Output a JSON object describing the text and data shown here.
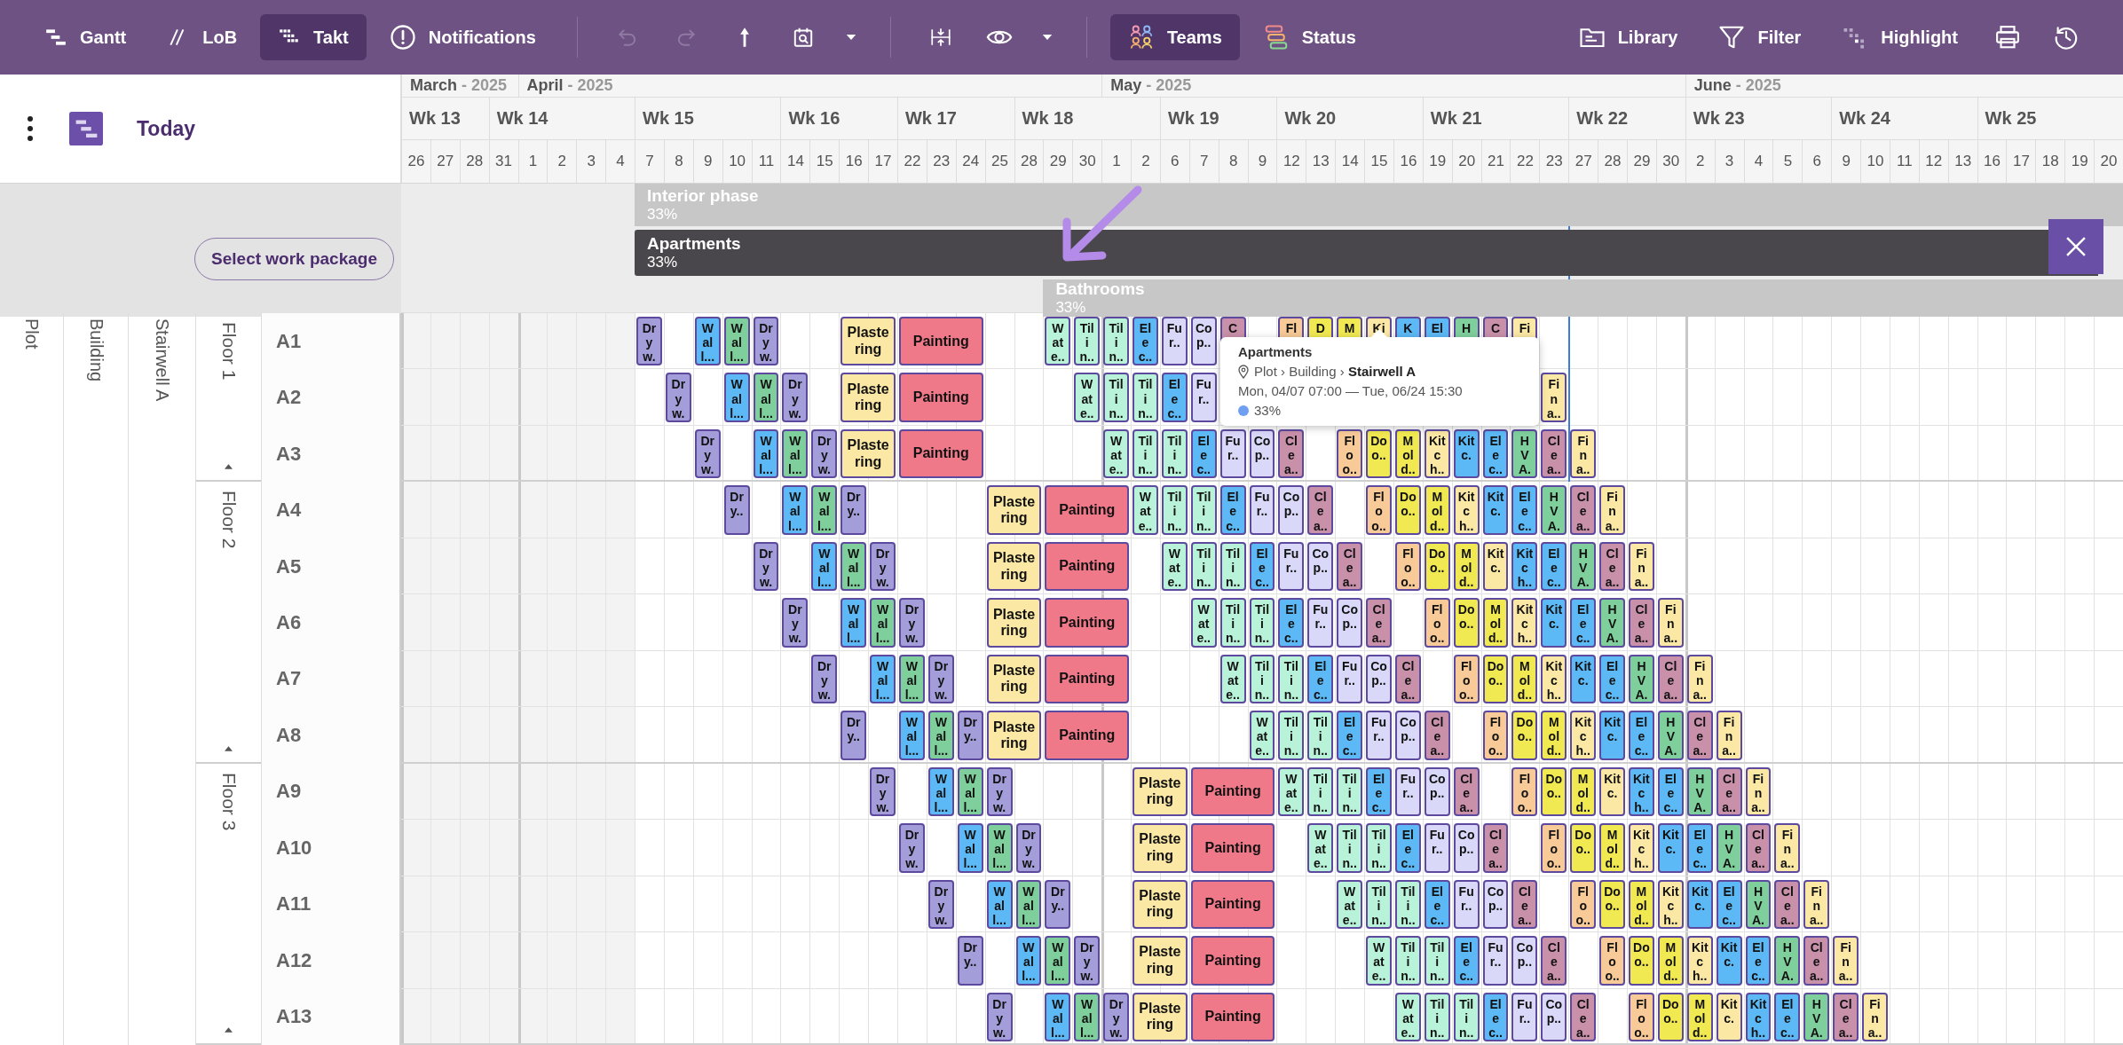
{
  "toolbar": {
    "views": [
      {
        "kind": "gantt",
        "label": "Gantt",
        "selected": false
      },
      {
        "kind": "lob",
        "label": "LoB",
        "selected": false
      },
      {
        "kind": "takt",
        "label": "Takt",
        "selected": true
      }
    ],
    "notifications": {
      "label": "Notifications"
    },
    "actions": [
      {
        "kind": "undo",
        "disabled": true
      },
      {
        "kind": "redo",
        "disabled": true
      },
      {
        "kind": "pin",
        "disabled": false
      },
      {
        "kind": "calendar",
        "disabled": false
      },
      {
        "kind": "caret",
        "disabled": false
      }
    ],
    "view_actions": [
      {
        "kind": "compress"
      },
      {
        "kind": "eye"
      },
      {
        "kind": "caret"
      }
    ],
    "modes": [
      {
        "kind": "teams",
        "label": "Teams",
        "selected": true
      },
      {
        "kind": "status",
        "label": "Status",
        "selected": false
      }
    ],
    "tools": [
      {
        "kind": "library",
        "label": "Library"
      },
      {
        "kind": "filter",
        "label": "Filter"
      },
      {
        "kind": "highlight",
        "label": "Highlight"
      }
    ],
    "utilities": [
      {
        "kind": "print"
      },
      {
        "kind": "history"
      }
    ]
  },
  "sidebar_header": {
    "today": "Today"
  },
  "timeline": {
    "weeks": [
      {
        "label": "Wk 13",
        "shaded": true,
        "days": [
          {
            "label": "26",
            "month": {
              "name": "March",
              "year": "- 2025"
            }
          },
          {
            "label": "27"
          },
          {
            "label": "28"
          }
        ]
      },
      {
        "label": "Wk 14",
        "shaded": true,
        "days": [
          {
            "label": "31"
          },
          {
            "label": "1",
            "month": {
              "name": "April",
              "year": "- 2025"
            }
          },
          {
            "label": "2"
          },
          {
            "label": "3"
          },
          {
            "label": "4"
          }
        ]
      },
      {
        "label": "Wk 15",
        "shaded": false,
        "days": [
          {
            "label": "7"
          },
          {
            "label": "8"
          },
          {
            "label": "9"
          },
          {
            "label": "10"
          },
          {
            "label": "11"
          }
        ]
      },
      {
        "label": "Wk 16",
        "shaded": false,
        "days": [
          {
            "label": "14"
          },
          {
            "label": "15"
          },
          {
            "label": "16"
          },
          {
            "label": "17"
          }
        ]
      },
      {
        "label": "Wk 17",
        "shaded": false,
        "days": [
          {
            "label": "22"
          },
          {
            "label": "23"
          },
          {
            "label": "24"
          },
          {
            "label": "25"
          }
        ]
      },
      {
        "label": "Wk 18",
        "shaded": false,
        "days": [
          {
            "label": "28"
          },
          {
            "label": "29"
          },
          {
            "label": "30"
          },
          {
            "label": "1",
            "month": {
              "name": "May",
              "year": "- 2025"
            }
          },
          {
            "label": "2"
          }
        ]
      },
      {
        "label": "Wk 19",
        "shaded": false,
        "days": [
          {
            "label": "6"
          },
          {
            "label": "7"
          },
          {
            "label": "8"
          },
          {
            "label": "9"
          }
        ]
      },
      {
        "label": "Wk 20",
        "shaded": false,
        "days": [
          {
            "label": "12"
          },
          {
            "label": "13"
          },
          {
            "label": "14"
          },
          {
            "label": "15"
          },
          {
            "label": "16"
          }
        ]
      },
      {
        "label": "Wk 21",
        "shaded": false,
        "days": [
          {
            "label": "19"
          },
          {
            "label": "20"
          },
          {
            "label": "21"
          },
          {
            "label": "22"
          },
          {
            "label": "23"
          }
        ]
      },
      {
        "label": "Wk 22",
        "shaded": false,
        "days": [
          {
            "label": "27"
          },
          {
            "label": "28"
          },
          {
            "label": "29"
          },
          {
            "label": "30"
          }
        ]
      },
      {
        "label": "Wk 23",
        "shaded": false,
        "days": [
          {
            "label": "2",
            "month": {
              "name": "June",
              "year": "- 2025"
            }
          },
          {
            "label": "3"
          },
          {
            "label": "4"
          },
          {
            "label": "5"
          },
          {
            "label": "6"
          }
        ]
      },
      {
        "label": "Wk 24",
        "shaded": false,
        "days": [
          {
            "label": "9"
          },
          {
            "label": "10"
          },
          {
            "label": "11"
          },
          {
            "label": "12"
          },
          {
            "label": "13"
          }
        ]
      },
      {
        "label": "Wk 25",
        "shaded": false,
        "days": [
          {
            "label": "16"
          },
          {
            "label": "17"
          },
          {
            "label": "18"
          },
          {
            "label": "19"
          },
          {
            "label": "20"
          }
        ]
      }
    ]
  },
  "work_packages": {
    "button": "Select work package",
    "phases": [
      {
        "name": "Interior phase",
        "progress": "33%",
        "selected": false
      },
      {
        "name": "Apartments",
        "progress": "33%",
        "selected": true
      },
      {
        "name": "Bathrooms",
        "progress": "33%",
        "selected": false
      }
    ]
  },
  "location": {
    "plot": "Plot",
    "building": "Building",
    "stairwell": "Stairwell A",
    "floors": [
      {
        "label": "Floor 1",
        "rows": [
          {
            "label": "A1",
            "tasks": [
              {
                "name": "Dryw.",
                "color": "#a39dd9"
              },
              {
                "name": "Wall...",
                "color": "#5cb9f6"
              },
              {
                "name": "Wall...",
                "color": "#7fcf9c"
              },
              {
                "name": "Dryw.",
                "color": "#a39dd9"
              },
              {
                "name": "Plastering",
                "color": "#fbe8a4"
              },
              {
                "name": "Painting",
                "color": "#ef7889"
              },
              {
                "name": "Wate..",
                "color": "#b8f2d8"
              },
              {
                "name": "Tilin..",
                "color": "#b8f2d8"
              },
              {
                "name": "Tilin..",
                "color": "#b8f2d8"
              },
              {
                "name": "Elec..",
                "color": "#5cb9f6"
              },
              {
                "name": "Fur..",
                "color": "#d9d8f8"
              },
              {
                "name": "Cop..",
                "color": "#d9d8f8"
              },
              {
                "name": "C",
                "color": "#c990aa"
              },
              {
                "name": "Fl",
                "color": "#f7ca97"
              },
              {
                "name": "D",
                "color": "#f1e951"
              },
              {
                "name": "M",
                "color": "#f1e951"
              },
              {
                "name": "Ki",
                "color": "#fbe8a4"
              },
              {
                "name": "K",
                "color": "#5cb9f6"
              },
              {
                "name": "El",
                "color": "#5cb9f6"
              },
              {
                "name": "H",
                "color": "#7fcf9c"
              },
              {
                "name": "C",
                "color": "#c990aa"
              },
              {
                "name": "Fi",
                "color": "#fbe8a4"
              }
            ]
          },
          {
            "label": "A2",
            "tasks": [
              {
                "name": "Dryw.",
                "color": "#a39dd9"
              },
              {
                "name": "Wall...",
                "color": "#5cb9f6"
              },
              {
                "name": "Wall...",
                "color": "#7fcf9c"
              },
              {
                "name": "Dryw.",
                "color": "#a39dd9"
              },
              {
                "name": "Plastering",
                "color": "#fbe8a4"
              },
              {
                "name": "Painting",
                "color": "#ef7889"
              },
              {
                "name": "Wate..",
                "color": "#b8f2d8"
              },
              {
                "name": "Tilin..",
                "color": "#b8f2d8"
              },
              {
                "name": "Tilin..",
                "color": "#b8f2d8"
              },
              {
                "name": "Elec..",
                "color": "#5cb9f6"
              },
              {
                "name": "Fur..",
                "color": "#d9d8f8"
              },
              {
                "name": "Fina..",
                "color": "#fbe8a4"
              }
            ]
          },
          {
            "label": "A3",
            "tasks": [
              {
                "name": "Dryw.",
                "color": "#a39dd9"
              },
              {
                "name": "Wall...",
                "color": "#5cb9f6"
              },
              {
                "name": "Wall...",
                "color": "#7fcf9c"
              },
              {
                "name": "Dryw.",
                "color": "#a39dd9"
              },
              {
                "name": "Plastering",
                "color": "#fbe8a4"
              },
              {
                "name": "Painting",
                "color": "#ef7889"
              },
              {
                "name": "Wate..",
                "color": "#b8f2d8"
              },
              {
                "name": "Tilin..",
                "color": "#b8f2d8"
              },
              {
                "name": "Tilin..",
                "color": "#b8f2d8"
              },
              {
                "name": "Elec..",
                "color": "#5cb9f6"
              },
              {
                "name": "Fur..",
                "color": "#d9d8f8"
              },
              {
                "name": "Cop..",
                "color": "#d9d8f8"
              },
              {
                "name": "Clea..",
                "color": "#c990aa"
              },
              {
                "name": "Floo..",
                "color": "#f7ca97"
              },
              {
                "name": "Doo..",
                "color": "#f1e951"
              },
              {
                "name": "Mold..",
                "color": "#f1e951"
              },
              {
                "name": "Kitch..",
                "color": "#fbe8a4"
              },
              {
                "name": "Kitc.",
                "color": "#5cb9f6"
              },
              {
                "name": "Elec..",
                "color": "#5cb9f6"
              },
              {
                "name": "HVA.",
                "color": "#7fcf9c"
              },
              {
                "name": "Clea..",
                "color": "#c990aa"
              },
              {
                "name": "Fina..",
                "color": "#fbe8a4"
              }
            ]
          }
        ]
      },
      {
        "label": "Floor 2",
        "rows": [
          {
            "label": "A4",
            "tasks": [
              {
                "name": "Dry..",
                "color": "#a39dd9"
              },
              {
                "name": "Wall...",
                "color": "#5cb9f6"
              },
              {
                "name": "Wall...",
                "color": "#7fcf9c"
              },
              {
                "name": "Dry..",
                "color": "#a39dd9"
              },
              {
                "name": "Plastering",
                "color": "#fbe8a4"
              },
              {
                "name": "Painting",
                "color": "#ef7889"
              },
              {
                "name": "Wate..",
                "color": "#b8f2d8"
              },
              {
                "name": "Tilin..",
                "color": "#b8f2d8"
              },
              {
                "name": "Tilin..",
                "color": "#b8f2d8"
              },
              {
                "name": "Elec..",
                "color": "#5cb9f6"
              },
              {
                "name": "Fur..",
                "color": "#d9d8f8"
              },
              {
                "name": "Cop..",
                "color": "#d9d8f8"
              },
              {
                "name": "Clea..",
                "color": "#c990aa"
              },
              {
                "name": "Floo..",
                "color": "#f7ca97"
              },
              {
                "name": "Doo..",
                "color": "#f1e951"
              },
              {
                "name": "Mold..",
                "color": "#f1e951"
              },
              {
                "name": "Kitch..",
                "color": "#fbe8a4"
              },
              {
                "name": "Kitc.",
                "color": "#5cb9f6"
              },
              {
                "name": "Elec..",
                "color": "#5cb9f6"
              },
              {
                "name": "HVA.",
                "color": "#7fcf9c"
              },
              {
                "name": "Clea..",
                "color": "#c990aa"
              },
              {
                "name": "Fina..",
                "color": "#fbe8a4"
              }
            ]
          },
          {
            "label": "A5",
            "tasks": [
              {
                "name": "Dryw.",
                "color": "#a39dd9"
              },
              {
                "name": "Wall...",
                "color": "#5cb9f6"
              },
              {
                "name": "Wall...",
                "color": "#7fcf9c"
              },
              {
                "name": "Dryw.",
                "color": "#a39dd9"
              },
              {
                "name": "Plastering",
                "color": "#fbe8a4"
              },
              {
                "name": "Painting",
                "color": "#ef7889"
              },
              {
                "name": "Wate..",
                "color": "#b8f2d8"
              },
              {
                "name": "Tilin..",
                "color": "#b8f2d8"
              },
              {
                "name": "Tilin..",
                "color": "#b8f2d8"
              },
              {
                "name": "Elec..",
                "color": "#5cb9f6"
              },
              {
                "name": "Fur..",
                "color": "#d9d8f8"
              },
              {
                "name": "Cop..",
                "color": "#d9d8f8"
              },
              {
                "name": "Clea..",
                "color": "#c990aa"
              },
              {
                "name": "Floo..",
                "color": "#f7ca97"
              },
              {
                "name": "Doo..",
                "color": "#f1e951"
              },
              {
                "name": "Mold..",
                "color": "#f1e951"
              },
              {
                "name": "Kitc.",
                "color": "#fbe8a4"
              },
              {
                "name": "Kitch..",
                "color": "#5cb9f6"
              },
              {
                "name": "Elec..",
                "color": "#5cb9f6"
              },
              {
                "name": "HVA.",
                "color": "#7fcf9c"
              },
              {
                "name": "Clea..",
                "color": "#c990aa"
              },
              {
                "name": "Fina..",
                "color": "#fbe8a4"
              }
            ]
          },
          {
            "label": "A6",
            "tasks": [
              {
                "name": "Dryw.",
                "color": "#a39dd9"
              },
              {
                "name": "Wall...",
                "color": "#5cb9f6"
              },
              {
                "name": "Wall...",
                "color": "#7fcf9c"
              },
              {
                "name": "Dryw.",
                "color": "#a39dd9"
              },
              {
                "name": "Plastering",
                "color": "#fbe8a4"
              },
              {
                "name": "Painting",
                "color": "#ef7889"
              },
              {
                "name": "Wate..",
                "color": "#b8f2d8"
              },
              {
                "name": "Tilin..",
                "color": "#b8f2d8"
              },
              {
                "name": "Tilin..",
                "color": "#b8f2d8"
              },
              {
                "name": "Elec..",
                "color": "#5cb9f6"
              },
              {
                "name": "Fur..",
                "color": "#d9d8f8"
              },
              {
                "name": "Cop..",
                "color": "#d9d8f8"
              },
              {
                "name": "Clea..",
                "color": "#c990aa"
              },
              {
                "name": "Floo..",
                "color": "#f7ca97"
              },
              {
                "name": "Doo..",
                "color": "#f1e951"
              },
              {
                "name": "Mold..",
                "color": "#f1e951"
              },
              {
                "name": "Kitch..",
                "color": "#fbe8a4"
              },
              {
                "name": "Kitc.",
                "color": "#5cb9f6"
              },
              {
                "name": "Elec..",
                "color": "#5cb9f6"
              },
              {
                "name": "HVA.",
                "color": "#7fcf9c"
              },
              {
                "name": "Clea..",
                "color": "#c990aa"
              },
              {
                "name": "Fina..",
                "color": "#fbe8a4"
              }
            ]
          },
          {
            "label": "A7",
            "tasks": [
              {
                "name": "Dryw.",
                "color": "#a39dd9"
              },
              {
                "name": "Wall...",
                "color": "#5cb9f6"
              },
              {
                "name": "Wall...",
                "color": "#7fcf9c"
              },
              {
                "name": "Dryw.",
                "color": "#a39dd9"
              },
              {
                "name": "Plastering",
                "color": "#fbe8a4"
              },
              {
                "name": "Painting",
                "color": "#ef7889"
              },
              {
                "name": "Wate..",
                "color": "#b8f2d8"
              },
              {
                "name": "Tilin..",
                "color": "#b8f2d8"
              },
              {
                "name": "Tilin..",
                "color": "#b8f2d8"
              },
              {
                "name": "Elec..",
                "color": "#5cb9f6"
              },
              {
                "name": "Fur..",
                "color": "#d9d8f8"
              },
              {
                "name": "Cop..",
                "color": "#d9d8f8"
              },
              {
                "name": "Clea..",
                "color": "#c990aa"
              },
              {
                "name": "Floo..",
                "color": "#f7ca97"
              },
              {
                "name": "Doo..",
                "color": "#f1e951"
              },
              {
                "name": "Mold..",
                "color": "#f1e951"
              },
              {
                "name": "Kitch..",
                "color": "#fbe8a4"
              },
              {
                "name": "Kitc.",
                "color": "#5cb9f6"
              },
              {
                "name": "Elec..",
                "color": "#5cb9f6"
              },
              {
                "name": "HVA.",
                "color": "#7fcf9c"
              },
              {
                "name": "Clea..",
                "color": "#c990aa"
              },
              {
                "name": "Fina..",
                "color": "#fbe8a4"
              }
            ]
          },
          {
            "label": "A8",
            "tasks": [
              {
                "name": "Dry..",
                "color": "#a39dd9"
              },
              {
                "name": "Wall...",
                "color": "#5cb9f6"
              },
              {
                "name": "Wall...",
                "color": "#7fcf9c"
              },
              {
                "name": "Dry..",
                "color": "#a39dd9"
              },
              {
                "name": "Plastering",
                "color": "#fbe8a4"
              },
              {
                "name": "Painting",
                "color": "#ef7889"
              },
              {
                "name": "Wate..",
                "color": "#b8f2d8"
              },
              {
                "name": "Tilin..",
                "color": "#b8f2d8"
              },
              {
                "name": "Tilin..",
                "color": "#b8f2d8"
              },
              {
                "name": "Elec..",
                "color": "#5cb9f6"
              },
              {
                "name": "Fur..",
                "color": "#d9d8f8"
              },
              {
                "name": "Cop..",
                "color": "#d9d8f8"
              },
              {
                "name": "Clea..",
                "color": "#c990aa"
              },
              {
                "name": "Floo..",
                "color": "#f7ca97"
              },
              {
                "name": "Doo..",
                "color": "#f1e951"
              },
              {
                "name": "Mold..",
                "color": "#f1e951"
              },
              {
                "name": "Kitch..",
                "color": "#fbe8a4"
              },
              {
                "name": "Kitc.",
                "color": "#5cb9f6"
              },
              {
                "name": "Elec..",
                "color": "#5cb9f6"
              },
              {
                "name": "HVA.",
                "color": "#7fcf9c"
              },
              {
                "name": "Clea..",
                "color": "#c990aa"
              },
              {
                "name": "Fina..",
                "color": "#fbe8a4"
              }
            ]
          }
        ]
      },
      {
        "label": "Floor 3",
        "rows": [
          {
            "label": "A9",
            "tasks": [
              {
                "name": "Dryw.",
                "color": "#a39dd9"
              },
              {
                "name": "Wall...",
                "color": "#5cb9f6"
              },
              {
                "name": "Wall...",
                "color": "#7fcf9c"
              },
              {
                "name": "Dryw.",
                "color": "#a39dd9"
              },
              {
                "name": "Plastering",
                "color": "#fbe8a4"
              },
              {
                "name": "Painting",
                "color": "#ef7889"
              },
              {
                "name": "Wate..",
                "color": "#b8f2d8"
              },
              {
                "name": "Tilin..",
                "color": "#b8f2d8"
              },
              {
                "name": "Tilin..",
                "color": "#b8f2d8"
              },
              {
                "name": "Elec..",
                "color": "#5cb9f6"
              },
              {
                "name": "Fur..",
                "color": "#d9d8f8"
              },
              {
                "name": "Cop..",
                "color": "#d9d8f8"
              },
              {
                "name": "Clea..",
                "color": "#c990aa"
              },
              {
                "name": "Floo..",
                "color": "#f7ca97"
              },
              {
                "name": "Doo..",
                "color": "#f1e951"
              },
              {
                "name": "Mold..",
                "color": "#f1e951"
              },
              {
                "name": "Kitc.",
                "color": "#fbe8a4"
              },
              {
                "name": "Kitch..",
                "color": "#5cb9f6"
              },
              {
                "name": "Elec..",
                "color": "#5cb9f6"
              },
              {
                "name": "HVA.",
                "color": "#7fcf9c"
              },
              {
                "name": "Clea..",
                "color": "#c990aa"
              },
              {
                "name": "Fina..",
                "color": "#fbe8a4"
              }
            ]
          },
          {
            "label": "A10",
            "tasks": [
              {
                "name": "Dryw.",
                "color": "#a39dd9"
              },
              {
                "name": "Wall...",
                "color": "#5cb9f6"
              },
              {
                "name": "Wall...",
                "color": "#7fcf9c"
              },
              {
                "name": "Dryw.",
                "color": "#a39dd9"
              },
              {
                "name": "Plastering",
                "color": "#fbe8a4"
              },
              {
                "name": "Painting",
                "color": "#ef7889"
              },
              {
                "name": "Wate..",
                "color": "#b8f2d8"
              },
              {
                "name": "Tilin..",
                "color": "#b8f2d8"
              },
              {
                "name": "Tilin..",
                "color": "#b8f2d8"
              },
              {
                "name": "Elec..",
                "color": "#5cb9f6"
              },
              {
                "name": "Fur..",
                "color": "#d9d8f8"
              },
              {
                "name": "Cop..",
                "color": "#d9d8f8"
              },
              {
                "name": "Clea..",
                "color": "#c990aa"
              },
              {
                "name": "Floo..",
                "color": "#f7ca97"
              },
              {
                "name": "Doo..",
                "color": "#f1e951"
              },
              {
                "name": "Mold..",
                "color": "#f1e951"
              },
              {
                "name": "Kitch..",
                "color": "#fbe8a4"
              },
              {
                "name": "Kitc.",
                "color": "#5cb9f6"
              },
              {
                "name": "Elec..",
                "color": "#5cb9f6"
              },
              {
                "name": "HVA.",
                "color": "#7fcf9c"
              },
              {
                "name": "Clea..",
                "color": "#c990aa"
              },
              {
                "name": "Fina..",
                "color": "#fbe8a4"
              }
            ]
          },
          {
            "label": "A11",
            "tasks": [
              {
                "name": "Dryw.",
                "color": "#a39dd9"
              },
              {
                "name": "Wall...",
                "color": "#5cb9f6"
              },
              {
                "name": "Wall...",
                "color": "#7fcf9c"
              },
              {
                "name": "Dry..",
                "color": "#a39dd9"
              },
              {
                "name": "Plastering",
                "color": "#fbe8a4"
              },
              {
                "name": "Painting",
                "color": "#ef7889"
              },
              {
                "name": "Wate..",
                "color": "#b8f2d8"
              },
              {
                "name": "Tilin..",
                "color": "#b8f2d8"
              },
              {
                "name": "Tilin..",
                "color": "#b8f2d8"
              },
              {
                "name": "Elec..",
                "color": "#5cb9f6"
              },
              {
                "name": "Fur..",
                "color": "#d9d8f8"
              },
              {
                "name": "Cop..",
                "color": "#d9d8f8"
              },
              {
                "name": "Clea..",
                "color": "#c990aa"
              },
              {
                "name": "Floo..",
                "color": "#f7ca97"
              },
              {
                "name": "Doo..",
                "color": "#f1e951"
              },
              {
                "name": "Mold..",
                "color": "#f1e951"
              },
              {
                "name": "Kitch..",
                "color": "#fbe8a4"
              },
              {
                "name": "Kitc.",
                "color": "#5cb9f6"
              },
              {
                "name": "Elec..",
                "color": "#5cb9f6"
              },
              {
                "name": "HVA.",
                "color": "#7fcf9c"
              },
              {
                "name": "Clea..",
                "color": "#c990aa"
              },
              {
                "name": "Fina..",
                "color": "#fbe8a4"
              }
            ]
          },
          {
            "label": "A12",
            "tasks": [
              {
                "name": "Dry..",
                "color": "#a39dd9"
              },
              {
                "name": "Wall...",
                "color": "#5cb9f6"
              },
              {
                "name": "Wall...",
                "color": "#7fcf9c"
              },
              {
                "name": "Dryw.",
                "color": "#a39dd9"
              },
              {
                "name": "Plastering",
                "color": "#fbe8a4"
              },
              {
                "name": "Painting",
                "color": "#ef7889"
              },
              {
                "name": "Wate..",
                "color": "#b8f2d8"
              },
              {
                "name": "Tilin..",
                "color": "#b8f2d8"
              },
              {
                "name": "Tilin..",
                "color": "#b8f2d8"
              },
              {
                "name": "Elec..",
                "color": "#5cb9f6"
              },
              {
                "name": "Fur..",
                "color": "#d9d8f8"
              },
              {
                "name": "Cop..",
                "color": "#d9d8f8"
              },
              {
                "name": "Clea..",
                "color": "#c990aa"
              },
              {
                "name": "Floo..",
                "color": "#f7ca97"
              },
              {
                "name": "Doo..",
                "color": "#f1e951"
              },
              {
                "name": "Mold..",
                "color": "#f1e951"
              },
              {
                "name": "Kitch..",
                "color": "#fbe8a4"
              },
              {
                "name": "Kitc.",
                "color": "#5cb9f6"
              },
              {
                "name": "Elec..",
                "color": "#5cb9f6"
              },
              {
                "name": "HVA.",
                "color": "#7fcf9c"
              },
              {
                "name": "Clea..",
                "color": "#c990aa"
              },
              {
                "name": "Fina..",
                "color": "#fbe8a4"
              }
            ]
          },
          {
            "label": "A13",
            "tasks": [
              {
                "name": "Dryw.",
                "color": "#a39dd9"
              },
              {
                "name": "Wall...",
                "color": "#5cb9f6"
              },
              {
                "name": "Wall...",
                "color": "#7fcf9c"
              },
              {
                "name": "Dryw.",
                "color": "#a39dd9"
              },
              {
                "name": "Plastering",
                "color": "#fbe8a4"
              },
              {
                "name": "Painting",
                "color": "#ef7889"
              },
              {
                "name": "Wate..",
                "color": "#b8f2d8"
              },
              {
                "name": "Tilin..",
                "color": "#b8f2d8"
              },
              {
                "name": "Tilin..",
                "color": "#b8f2d8"
              },
              {
                "name": "Elec..",
                "color": "#5cb9f6"
              },
              {
                "name": "Fur..",
                "color": "#d9d8f8"
              },
              {
                "name": "Cop..",
                "color": "#d9d8f8"
              },
              {
                "name": "Clea..",
                "color": "#c990aa"
              },
              {
                "name": "Floo..",
                "color": "#f7ca97"
              },
              {
                "name": "Doo..",
                "color": "#f1e951"
              },
              {
                "name": "Mold..",
                "color": "#f1e951"
              },
              {
                "name": "Kitc.",
                "color": "#fbe8a4"
              },
              {
                "name": "Kitch..",
                "color": "#5cb9f6"
              },
              {
                "name": "Elec..",
                "color": "#5cb9f6"
              },
              {
                "name": "HVA.",
                "color": "#7fcf9c"
              },
              {
                "name": "Clea..",
                "color": "#c990aa"
              },
              {
                "name": "Fina..",
                "color": "#fbe8a4"
              }
            ]
          }
        ]
      }
    ]
  },
  "tooltip": {
    "title": "Apartments",
    "path": "Plot › Building › **Stairwell A**",
    "dates": "Mon, 04/07 07:00 — Tue, 06/24 15:30",
    "progress": "33%"
  }
}
